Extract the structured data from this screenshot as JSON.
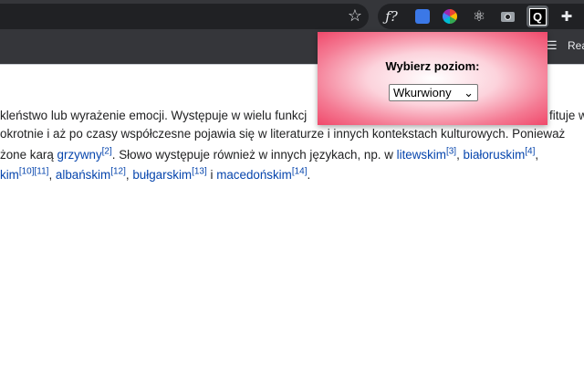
{
  "browser": {
    "bookmark_star": "☆",
    "extensions": [
      {
        "name": "function-icon",
        "glyph": "ƒ?"
      },
      {
        "name": "blue-square-icon",
        "glyph": "⬛"
      },
      {
        "name": "color-wheel-icon",
        "glyph": ""
      },
      {
        "name": "atom-icon",
        "glyph": "⚛"
      },
      {
        "name": "camera-icon",
        "glyph": ""
      },
      {
        "name": "q-icon",
        "glyph": "Q"
      },
      {
        "name": "puzzle-icon",
        "glyph": "✚"
      }
    ],
    "reader_label": "Rea"
  },
  "article": {
    "line1": "kleństwo lub wyrażenie emocji. Występuje w wielu funkcj",
    "line1_tail": "fituje w",
    "line2": "okrotnie i aż po czasy współczesne pojawia się w literaturze i innych kontekstach kulturowych. Ponieważ",
    "line3": {
      "pre": "żone karą ",
      "link1": "grzywny",
      "ref1": "[2]",
      "mid": ". Słowo występuje również w innych językach, np. w ",
      "link2": "litewskim",
      "ref2": "[3]",
      "sep": ", ",
      "link3": "białoruskim",
      "ref3": "[4]",
      "end": ","
    },
    "line4": {
      "link1": "kim",
      "ref1": "[10][11]",
      "sep1": ", ",
      "link2": "albańskim",
      "ref2": "[12]",
      "sep2": ", ",
      "link3": "bułgarskim",
      "ref3": "[13]",
      "and": " i ",
      "link4": "macedońskim",
      "ref4": "[14]",
      "end": "."
    }
  },
  "popup": {
    "title": "Wybierz poziom:",
    "selected": "Wkurwiony",
    "chevron": "⌄"
  }
}
